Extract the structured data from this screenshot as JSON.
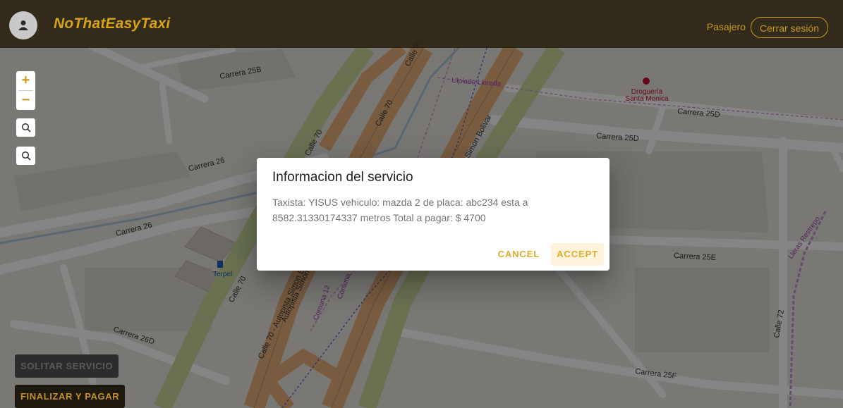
{
  "header": {
    "brand": "NoThatEasyTaxi",
    "role_label": "Pasajero",
    "logout_label": "Cerrar sesión"
  },
  "map": {
    "labels": {
      "carrera_25b": "Carrera 25B",
      "carrera_25d_top": "Carrera 25D",
      "carrera_25d": "Carrera 25D",
      "carrera_25e": "Carrera 25E",
      "carrera_25f": "Carrera 25F",
      "carrera_26_top": "Carrera 26",
      "carrera_26_mid": "Carrera 26",
      "carrera_26d": "Carrera 26D",
      "calle_70_a": "Calle 70",
      "calle_70_b": "Calle 70",
      "calle_70_c": "Calle 70",
      "calle_70_d": "Calle 70",
      "calle_70_autopista": "Calle 70 - Autopista Simon Bolivar",
      "simon_bolivar": "Simon Bolivar",
      "autopista_simon": "Autopista Simon B",
      "calle_72": "Calle 72",
      "ulpiado": "Ulpiado Lloreda",
      "lleras": "Lleras Restrepo",
      "comuna_12": "Comuna 12",
      "comuna": "Comuna",
      "drogueria_line1": "Droguería",
      "drogueria_line2": "Santa Monica",
      "terpel": "Terpel"
    }
  },
  "controls": {
    "zoom_in": "+",
    "zoom_out": "−"
  },
  "actions": {
    "solicitar": "SOLITAR SERVICIO",
    "finalizar": "FINALIZAR Y PAGAR"
  },
  "dialog": {
    "title": "Informacion del servicio",
    "message": "Taxista: YISUS vehiculo: mazda 2 de placa: abc234 esta a 8582.31330174337 metros Total a pagar: $ 4700",
    "cancel_label": "CANCEL",
    "accept_label": "ACCEPT"
  },
  "colors": {
    "accent": "#d7a417",
    "highway": "#e8b07c",
    "trunk": "#c9dc9a",
    "road": "#ffffff"
  }
}
